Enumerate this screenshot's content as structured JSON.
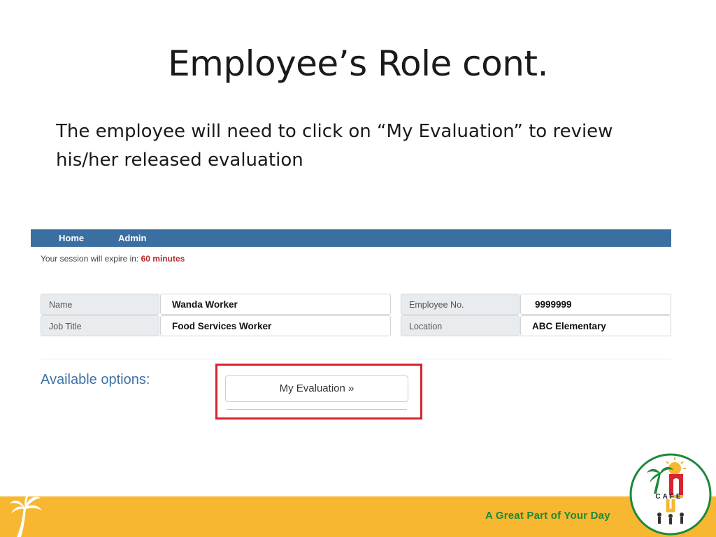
{
  "slide": {
    "title": "Employee’s Role cont.",
    "body": "The employee will need to click on “My Evaluation” to review his/her released evaluation"
  },
  "app": {
    "nav": {
      "home": "Home",
      "admin": "Admin"
    },
    "session": {
      "prefix": "Your session will expire in: ",
      "value": "60 minutes"
    },
    "fields": {
      "name_label": "Name",
      "name_value": "Wanda Worker",
      "job_title_label": "Job Title",
      "job_title_value": "Food Services Worker",
      "employee_no_label": "Employee No.",
      "employee_no_value": "9999999",
      "location_label": "Location",
      "location_value": "ABC Elementary"
    },
    "options_heading": "Available options:",
    "my_evaluation_button": "My Evaluation »"
  },
  "footer": {
    "tagline": "A Great Part of Your Day",
    "logo_text": "CAFE"
  },
  "colors": {
    "navbar": "#3b6fa2",
    "highlight": "#d9232e",
    "footer": "#f7b731",
    "tagline": "#1b8a3a",
    "options_heading": "#3f73a6"
  },
  "icons": [
    "palm-tree-icon",
    "cafe-logo"
  ]
}
